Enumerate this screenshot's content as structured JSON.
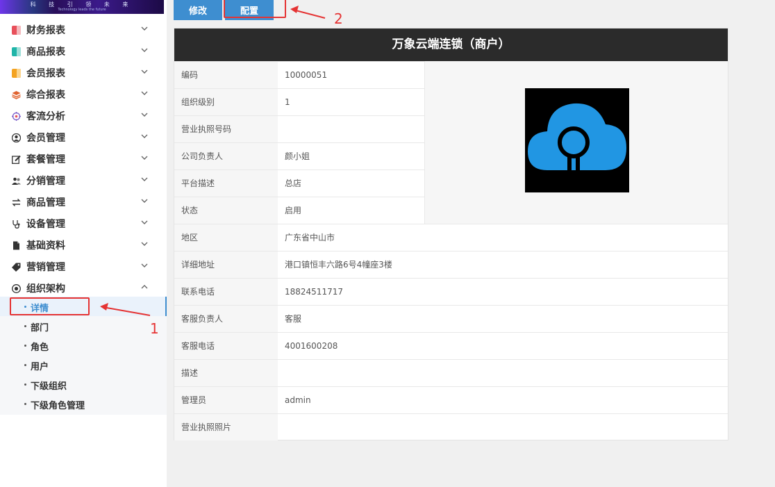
{
  "banner": {
    "title": "科 技 引 领 未 来",
    "subtitle": "Technology leads the future"
  },
  "sidebar": {
    "menu": [
      {
        "label": "财务报表",
        "icon": "finance-report-icon",
        "color": "#e8505b"
      },
      {
        "label": "商品报表",
        "icon": "goods-report-icon",
        "color": "#1fb5a8"
      },
      {
        "label": "会员报表",
        "icon": "member-report-icon",
        "color": "#f4a321"
      },
      {
        "label": "综合报表",
        "icon": "layers-icon",
        "color": "#e0622e"
      },
      {
        "label": "客流分析",
        "icon": "target-icon",
        "color": "#7a5cc9"
      },
      {
        "label": "会员管理",
        "icon": "user-icon",
        "color": "#333333"
      },
      {
        "label": "套餐管理",
        "icon": "edit-icon",
        "color": "#333333"
      },
      {
        "label": "分销管理",
        "icon": "users-icon",
        "color": "#333333"
      },
      {
        "label": "商品管理",
        "icon": "exchange-icon",
        "color": "#333333"
      },
      {
        "label": "设备管理",
        "icon": "stethoscope-icon",
        "color": "#333333"
      },
      {
        "label": "基础资料",
        "icon": "file-icon",
        "color": "#333333"
      },
      {
        "label": "营销管理",
        "icon": "tag-icon",
        "color": "#333333"
      },
      {
        "label": "组织架构",
        "icon": "org-icon",
        "color": "#333333"
      }
    ],
    "submenu": [
      {
        "label": "详情",
        "active": true
      },
      {
        "label": "部门"
      },
      {
        "label": "角色"
      },
      {
        "label": "用户"
      },
      {
        "label": "下级组织"
      },
      {
        "label": "下级角色管理"
      }
    ]
  },
  "toolbar": {
    "edit_label": "修改",
    "config_label": "配置"
  },
  "card": {
    "title": "万象云端连锁（商户）",
    "fields": [
      {
        "label": "编码",
        "value": "10000051"
      },
      {
        "label": "组织级别",
        "value": "1"
      },
      {
        "label": "营业执照号码",
        "value": ""
      },
      {
        "label": "公司负责人",
        "value": "颜小姐"
      },
      {
        "label": "平台描述",
        "value": "总店"
      },
      {
        "label": "状态",
        "value": "启用"
      },
      {
        "label": "地区",
        "value": "广东省中山市"
      },
      {
        "label": "详细地址",
        "value": "港口镇恒丰六路6号4幢座3楼"
      },
      {
        "label": "联系电话",
        "value": "18824511717"
      },
      {
        "label": "客服负责人",
        "value": "客服"
      },
      {
        "label": "客服电话",
        "value": "4001600208"
      },
      {
        "label": "描述",
        "value": ""
      },
      {
        "label": "管理员",
        "value": "admin"
      },
      {
        "label": "营业执照照片",
        "value": ""
      }
    ]
  },
  "annotations": {
    "marker_1": "1",
    "marker_2": "2",
    "color": "#e53333"
  },
  "colors": {
    "accent": "#3e8ed0",
    "header_bg": "#2b2b2b",
    "logo_cloud": "#2196e3"
  }
}
